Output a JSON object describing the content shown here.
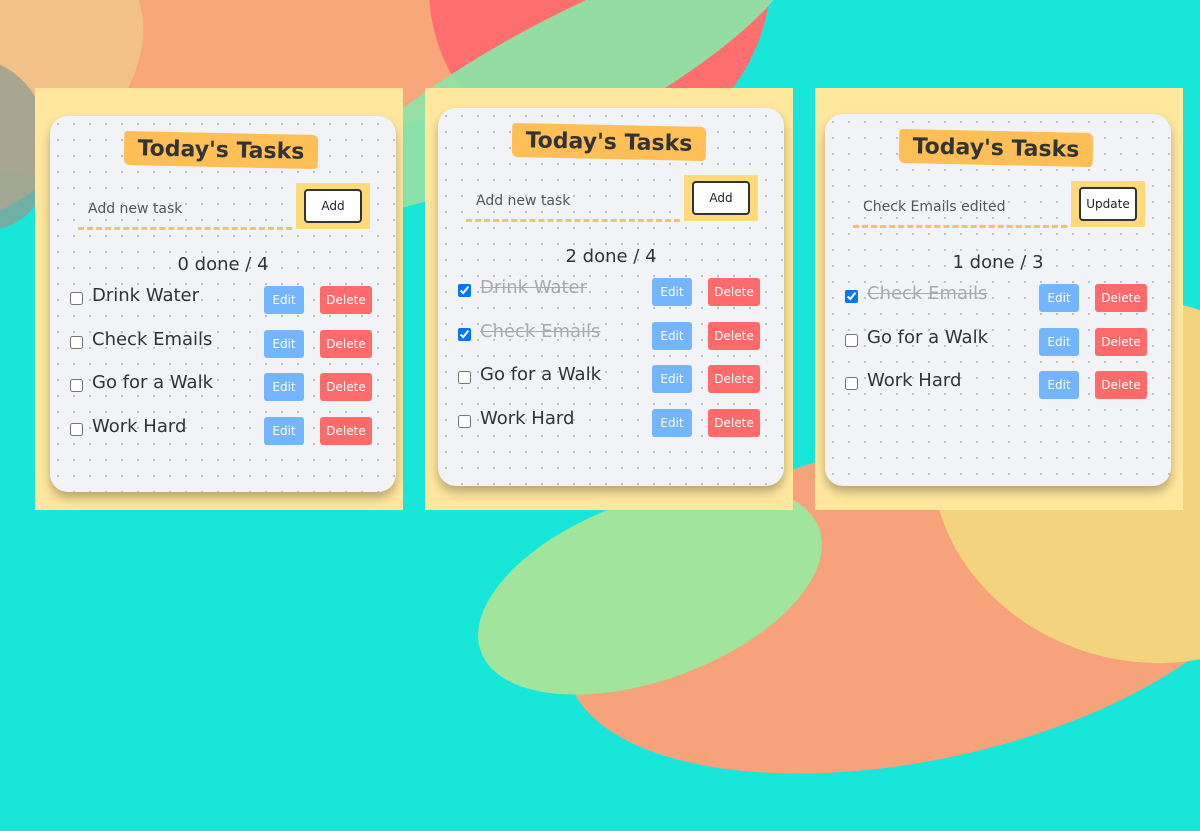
{
  "colors": {
    "background": "#17e6d8",
    "panel": "#ffe79d",
    "title_highlight": "#ffbf57",
    "edit_button": "#74b5ff",
    "delete_button": "#ff6b6b",
    "add_button_frame": "#ffd97a"
  },
  "panels": [
    {
      "title": "Today's Tasks",
      "input_value": "",
      "input_placeholder": "Add new task",
      "action_label": "Add",
      "counter": "0 done / 4",
      "tasks": [
        {
          "text": "Drink Water",
          "done": false,
          "edit_label": "Edit",
          "delete_label": "Delete"
        },
        {
          "text": "Check Emails",
          "done": false,
          "edit_label": "Edit",
          "delete_label": "Delete"
        },
        {
          "text": "Go for a Walk",
          "done": false,
          "edit_label": "Edit",
          "delete_label": "Delete"
        },
        {
          "text": "Work Hard",
          "done": false,
          "edit_label": "Edit",
          "delete_label": "Delete"
        }
      ]
    },
    {
      "title": "Today's Tasks",
      "input_value": "",
      "input_placeholder": "Add new task",
      "action_label": "Add",
      "counter": "2 done / 4",
      "tasks": [
        {
          "text": "Drink Water",
          "done": true,
          "edit_label": "Edit",
          "delete_label": "Delete"
        },
        {
          "text": "Check Emails",
          "done": true,
          "edit_label": "Edit",
          "delete_label": "Delete"
        },
        {
          "text": "Go for a Walk",
          "done": false,
          "edit_label": "Edit",
          "delete_label": "Delete"
        },
        {
          "text": "Work Hard",
          "done": false,
          "edit_label": "Edit",
          "delete_label": "Delete"
        }
      ]
    },
    {
      "title": "Today's Tasks",
      "input_value": "Check Emails edited",
      "input_placeholder": "Add new task",
      "action_label": "Update",
      "counter": "1 done / 3",
      "tasks": [
        {
          "text": "Check Emails",
          "done": true,
          "edit_label": "Edit",
          "delete_label": "Delete"
        },
        {
          "text": "Go for a Walk",
          "done": false,
          "edit_label": "Edit",
          "delete_label": "Delete"
        },
        {
          "text": "Work Hard",
          "done": false,
          "edit_label": "Edit",
          "delete_label": "Delete"
        }
      ]
    }
  ]
}
